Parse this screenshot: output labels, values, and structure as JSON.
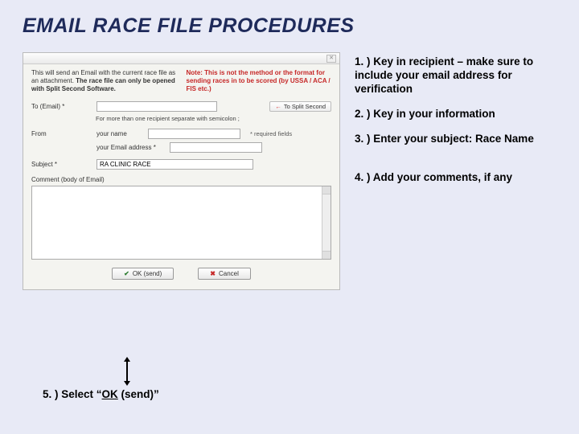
{
  "title": "EMAIL RACE FILE PROCEDURES",
  "dialog": {
    "info_left_1": "This will send an Email with the current race file as an attachment. ",
    "info_left_2": "The race file can only be opened with Split Second Software.",
    "info_right": "Note: This is not the method or the format for sending races in to be scored (by USSA / ACA / FIS etc.)",
    "to_split_btn": "To Split Second",
    "to_label": "To (Email) *",
    "to_hint": "For more than one recipient separate with semicolon ;",
    "from_label": "From",
    "your_name_label": "your name",
    "your_email_label": "your Email address *",
    "required_hint": "* required fields",
    "subject_label": "Subject *",
    "subject_value": "RA CLINIC RACE",
    "comment_label": "Comment (body of Email)",
    "ok_label": "OK (send)",
    "cancel_label": "Cancel"
  },
  "steps": {
    "s1": "1. ) Key in recipient – make sure to include your email address for verification",
    "s2": "2. ) Key in your information",
    "s3": "3. ) Enter your subject: Race Name",
    "s4": "4. ) Add your comments, if any",
    "s5a": "5. ) Select “",
    "s5b": "OK",
    "s5c": " (send)”"
  }
}
